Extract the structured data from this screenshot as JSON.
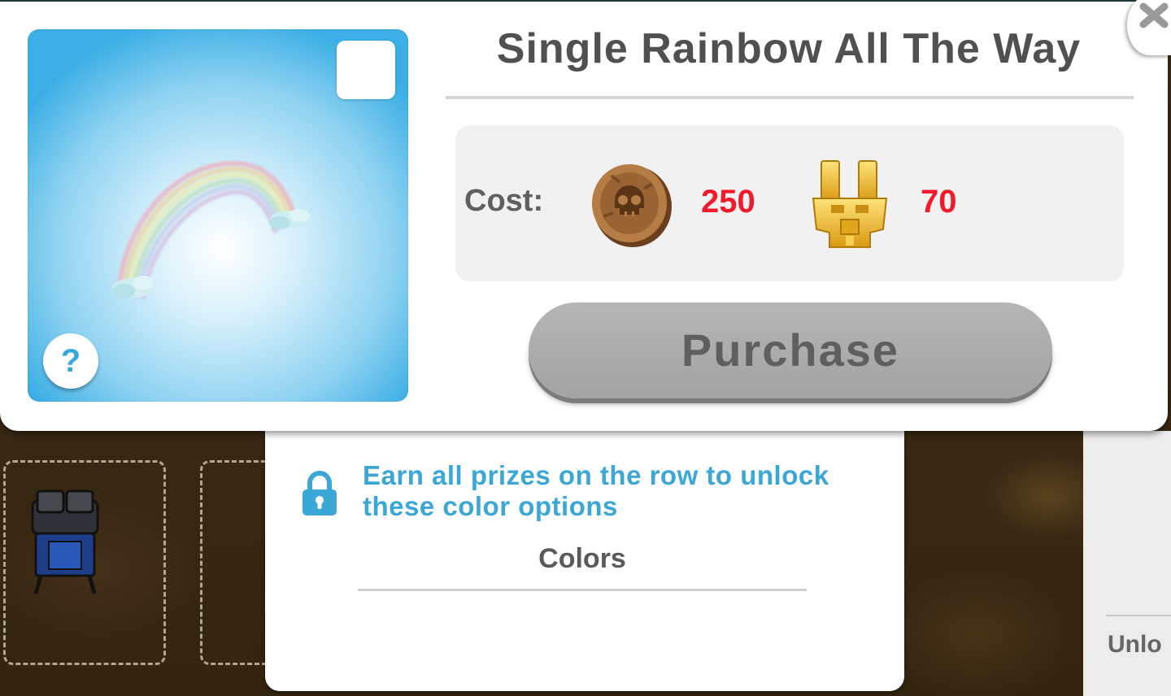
{
  "dialog": {
    "title": "Single Rainbow All The Way",
    "help_label": "?",
    "cost": {
      "label": "Cost:",
      "coins": "250",
      "totems": "70"
    },
    "purchase_label": "Purchase"
  },
  "colors_panel": {
    "locked_message": "Earn all prizes on the row to unlock these color options",
    "title": "Colors"
  },
  "side_panel": {
    "partial_text": "Unlo"
  },
  "icons": {
    "close": "close-icon",
    "help": "question-icon",
    "lock": "lock-icon",
    "coin": "skull-coin-icon",
    "totem": "gold-totem-icon"
  },
  "colors": {
    "price": "#f2192b",
    "accent": "#3aa7d6",
    "button_disabled": "#a9a9a9"
  }
}
